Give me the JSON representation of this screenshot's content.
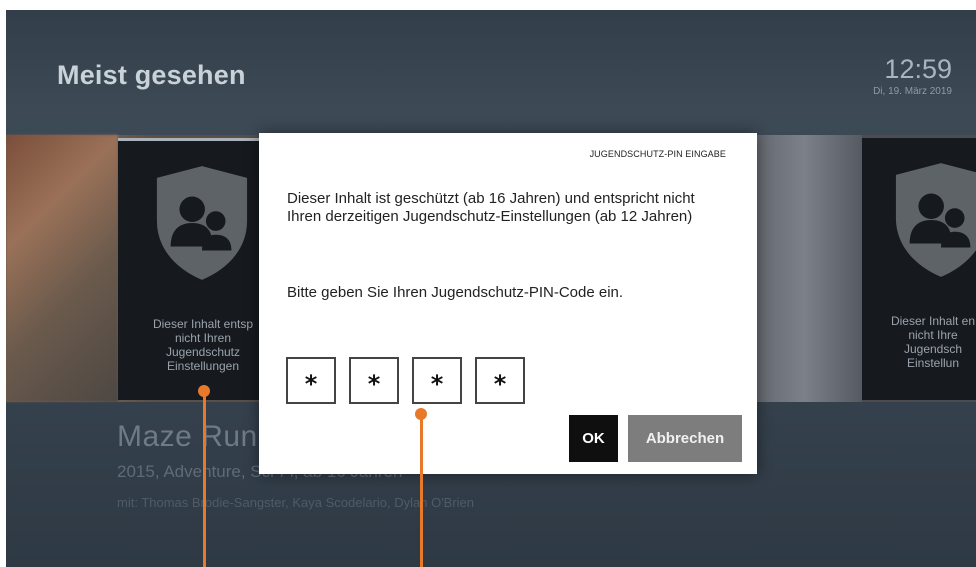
{
  "header": {
    "section_title": "Meist gesehen",
    "time": "12:59",
    "date": "Di, 19. März 2019"
  },
  "cards": [
    {
      "lock_message": "Dieser Inhalt entsp nicht Ihren Jugendschutz Einstellungen",
      "lines": [
        "Dieser Inhalt entsp",
        "nicht Ihren",
        "Jugendschutz",
        "Einstellungen"
      ]
    },
    {
      "lock_message": "Dieser Inhalt en nicht Ihre Jugendsch Einstellun",
      "lines": [
        "Dieser Inhalt en",
        "nicht Ihre",
        "Jugendsch",
        "Einstellun"
      ]
    }
  ],
  "movie": {
    "title": "Maze Run",
    "subtitle": "2015, Adventure, Sci-Fi, ab 16 Jahren",
    "cast": "mit: Thomas Brodie-Sangster, Kaya Scodelario, Dylan O'Brien"
  },
  "dialog": {
    "header": "JUGENDSCHUTZ-PIN EINGABE",
    "message": "Dieser Inhalt ist geschützt (ab 16 Jahren) und entspricht nicht Ihren derzeitigen Jugendschutz-Einstellungen (ab 12 Jahren)",
    "prompt": "Bitte geben Sie Ihren Jugendschutz-PIN-Code ein.",
    "pin_digits": [
      "*",
      "*",
      "*",
      "*"
    ],
    "ok_label": "OK",
    "cancel_label": "Abbrechen"
  },
  "icons": {
    "card_icon": "parental-lock-shield-icon"
  },
  "colors": {
    "callout": "#e8782a",
    "ok_button": "#0f0f0f",
    "cancel_button": "#7d7d7d"
  }
}
